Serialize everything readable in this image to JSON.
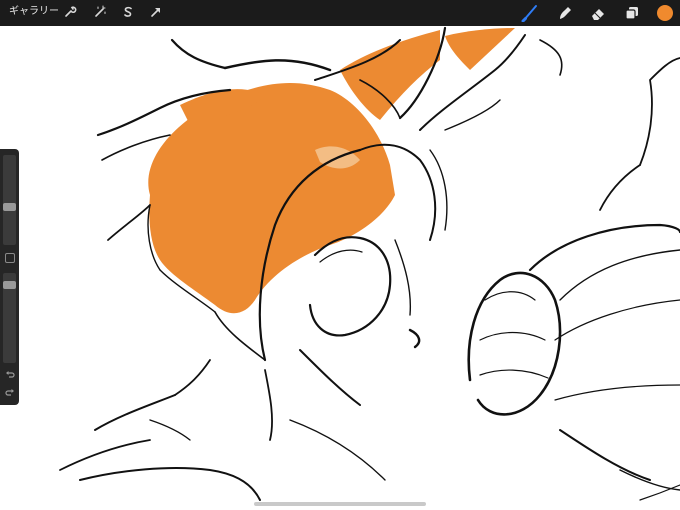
{
  "toolbar": {
    "gallery_label": "ギャラリー",
    "left_icons": [
      "wrench-icon",
      "magic-wand-icon",
      "selection-s-icon",
      "transform-arrow-icon"
    ],
    "right_icons": [
      "brush-icon",
      "smudge-icon",
      "eraser-icon",
      "layers-icon"
    ],
    "active_tool": "brush",
    "current_color": "#f08a2e"
  },
  "sidebar": {
    "brush_size_level": 0.42,
    "opacity_level": 0.1,
    "icons": [
      "modify-square-icon",
      "undo-icon",
      "redo-icon"
    ]
  },
  "colors": {
    "accent": "#2f7df6",
    "paint_orange": "#ec8a32",
    "paint_light": "#f3bd84",
    "toolbar_bg": "#1b1b1b",
    "sidebar_bg": "#262626"
  }
}
